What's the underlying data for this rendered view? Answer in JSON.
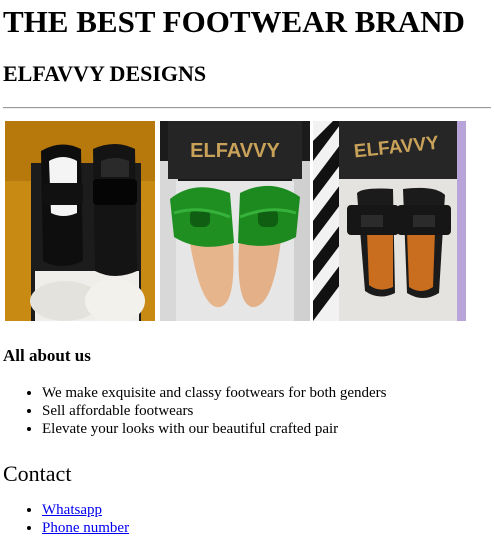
{
  "header": {
    "title": "THE BEST FOOTWEAR BRAND",
    "subtitle": "ELFAVVY DESIGNS"
  },
  "gallery": {
    "images": [
      {
        "icon": "black-slide-sandals-photo"
      },
      {
        "icon": "green-croc-slide-sandals-photo",
        "box_text": "ELFAVVY"
      },
      {
        "icon": "black-h-slide-sandals-photo",
        "box_text": "ELFAVVY"
      }
    ]
  },
  "about": {
    "heading": "All about us",
    "items": [
      "We make exquisite and classy footwears for both genders",
      "Sell affordable footwears",
      "Elevate your looks with our beautiful crafted pair"
    ]
  },
  "contact": {
    "heading": "Contact",
    "links": [
      "Whatsapp",
      "Phone number"
    ]
  },
  "colors": {
    "link": "#0000ee",
    "divider": "#9a9a9a"
  }
}
